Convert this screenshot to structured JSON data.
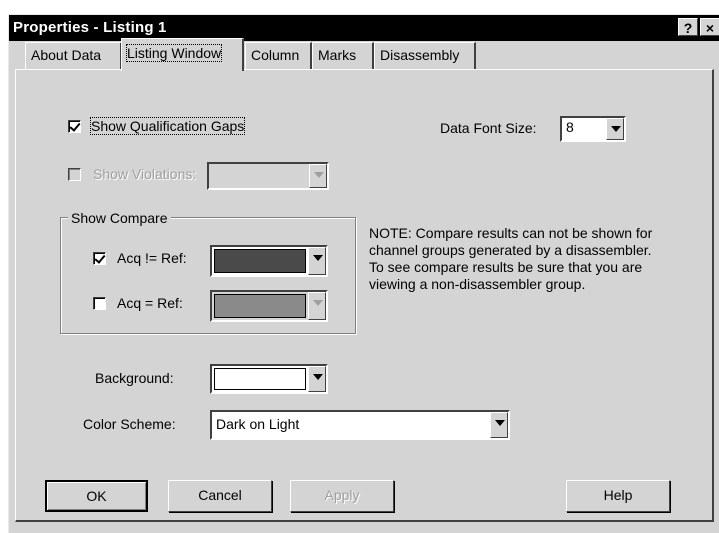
{
  "window": {
    "title": "Properties - Listing 1",
    "help_label": "?",
    "close_label": "×"
  },
  "tabs": [
    {
      "label": "About Data",
      "active": false
    },
    {
      "label": "Listing Window",
      "active": true
    },
    {
      "label": "Column",
      "active": false
    },
    {
      "label": "Marks",
      "active": false
    },
    {
      "label": "Disassembly",
      "active": false
    }
  ],
  "options": {
    "show_qualification_gaps": {
      "label": "Show Qualification Gaps",
      "checked": true
    },
    "show_violations": {
      "label": "Show Violations:",
      "checked": false,
      "enabled": false,
      "value": ""
    },
    "data_font_size": {
      "label": "Data Font Size:",
      "value": "8"
    }
  },
  "show_compare": {
    "title": "Show Compare",
    "acq_not_equal_ref": {
      "label": "Acq != Ref:",
      "checked": true,
      "color": "#4a4a4a"
    },
    "acq_equal_ref": {
      "label": "Acq = Ref:",
      "checked": false,
      "enabled": false,
      "color": "#8a8a8a"
    },
    "note": "NOTE: Compare results can not be shown for channel groups generated by a disassembler.  To see compare results be sure that you are viewing a non-disassembler group."
  },
  "background": {
    "label": "Background:",
    "color": "#ffffff"
  },
  "color_scheme": {
    "label": "Color Scheme:",
    "value": "Dark on Light"
  },
  "buttons": {
    "ok": "OK",
    "cancel": "Cancel",
    "apply": "Apply",
    "help": "Help"
  },
  "colors": {
    "dialog_face": "#d4d4d4",
    "titlebar": "#000000"
  }
}
